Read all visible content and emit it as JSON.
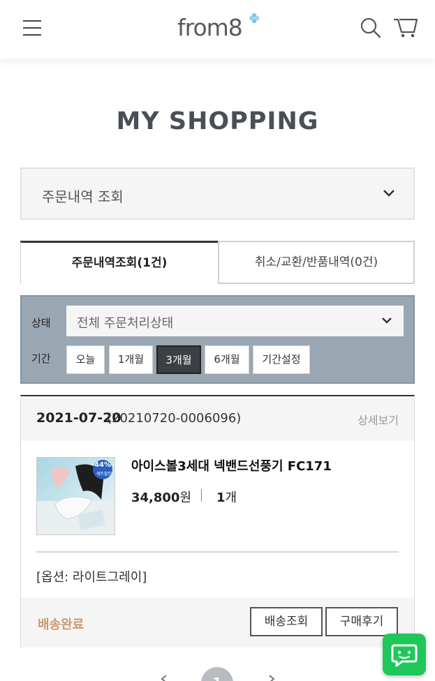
{
  "header": {
    "logo_text": "from8",
    "menu_icon": "hamburger-icon",
    "search_icon": "search-icon",
    "cart_icon": "cart-icon"
  },
  "page_title": "MY SHOPPING",
  "menu_select": {
    "label": "주문내역 조회"
  },
  "tabs": [
    {
      "label": "주문내역조회(1건)",
      "active": true
    },
    {
      "label": "취소/교환/반품내역(0건)",
      "active": false
    }
  ],
  "filter": {
    "status_label": "상태",
    "status_value": "전체 주문처리상태",
    "period_label": "기간",
    "period_buttons": [
      "오늘",
      "1개월",
      "3개월",
      "6개월",
      "기간설정"
    ],
    "period_active": "3개월"
  },
  "order": {
    "date": "2021-07-20",
    "order_no": "(20210720-0006096)",
    "detail_link": "상세보기",
    "product_name": "아이스볼3세대 넥밴드선풍기 FC171",
    "price_value": "34,800",
    "price_unit": "원",
    "qty_value": "1",
    "qty_unit": "개",
    "option": "[옵션: 라이트그레이]",
    "thumb_badge": "-44%",
    "thumb_badge_sub": "세트할인",
    "ship_status": "배송완료",
    "track_button": "배송조회",
    "review_button": "구매후기"
  },
  "pagination": {
    "current": "1"
  },
  "colors": {
    "accent_brown": "#c89a6e",
    "filter_bg": "#9aa7b3",
    "chat_green": "#1fc75a",
    "logo_blue": "#7cc6e8"
  }
}
